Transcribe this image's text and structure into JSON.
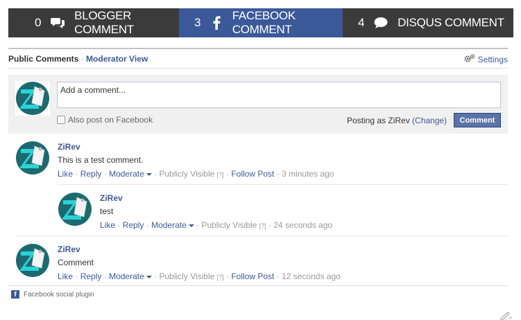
{
  "tabs": [
    {
      "count": "0",
      "label": "BLOGGER COMMENT",
      "icon": "chat-bubbles-icon"
    },
    {
      "count": "3",
      "label": "FACEBOOK COMMENT",
      "icon": "facebook-icon"
    },
    {
      "count": "4",
      "label": "DISQUS COMMENT",
      "icon": "chat-bubble-icon"
    }
  ],
  "header": {
    "public_label": "Public Comments",
    "separator": "·",
    "moderator_label": "Moderator View",
    "settings_label": "Settings"
  },
  "compose": {
    "placeholder": "Add a comment...",
    "also_post": "Also post on Facebook",
    "posting_as": "Posting as ZiRev",
    "change_label": "(Change)",
    "button_label": "Comment"
  },
  "actions": {
    "like": "Like",
    "reply": "Reply",
    "moderate": "Moderate",
    "visibility": "Publicly Visible",
    "help": "[?]",
    "follow": "Follow Post",
    "dot": "·"
  },
  "comments": [
    {
      "author": "ZiRev",
      "text": "This is a test comment.",
      "time": "3 minutes ago"
    },
    {
      "author": "ZiRev",
      "text": "test",
      "time": "24 seconds ago"
    },
    {
      "author": "ZiRev",
      "text": "Comment",
      "time": "12 seconds ago"
    }
  ],
  "footer": {
    "plugin_label": "Facebook social plugin"
  },
  "colors": {
    "brand": "#3b5998",
    "tab_dark": "#3b3b3b",
    "avatar_teal": "#1c6a70"
  }
}
